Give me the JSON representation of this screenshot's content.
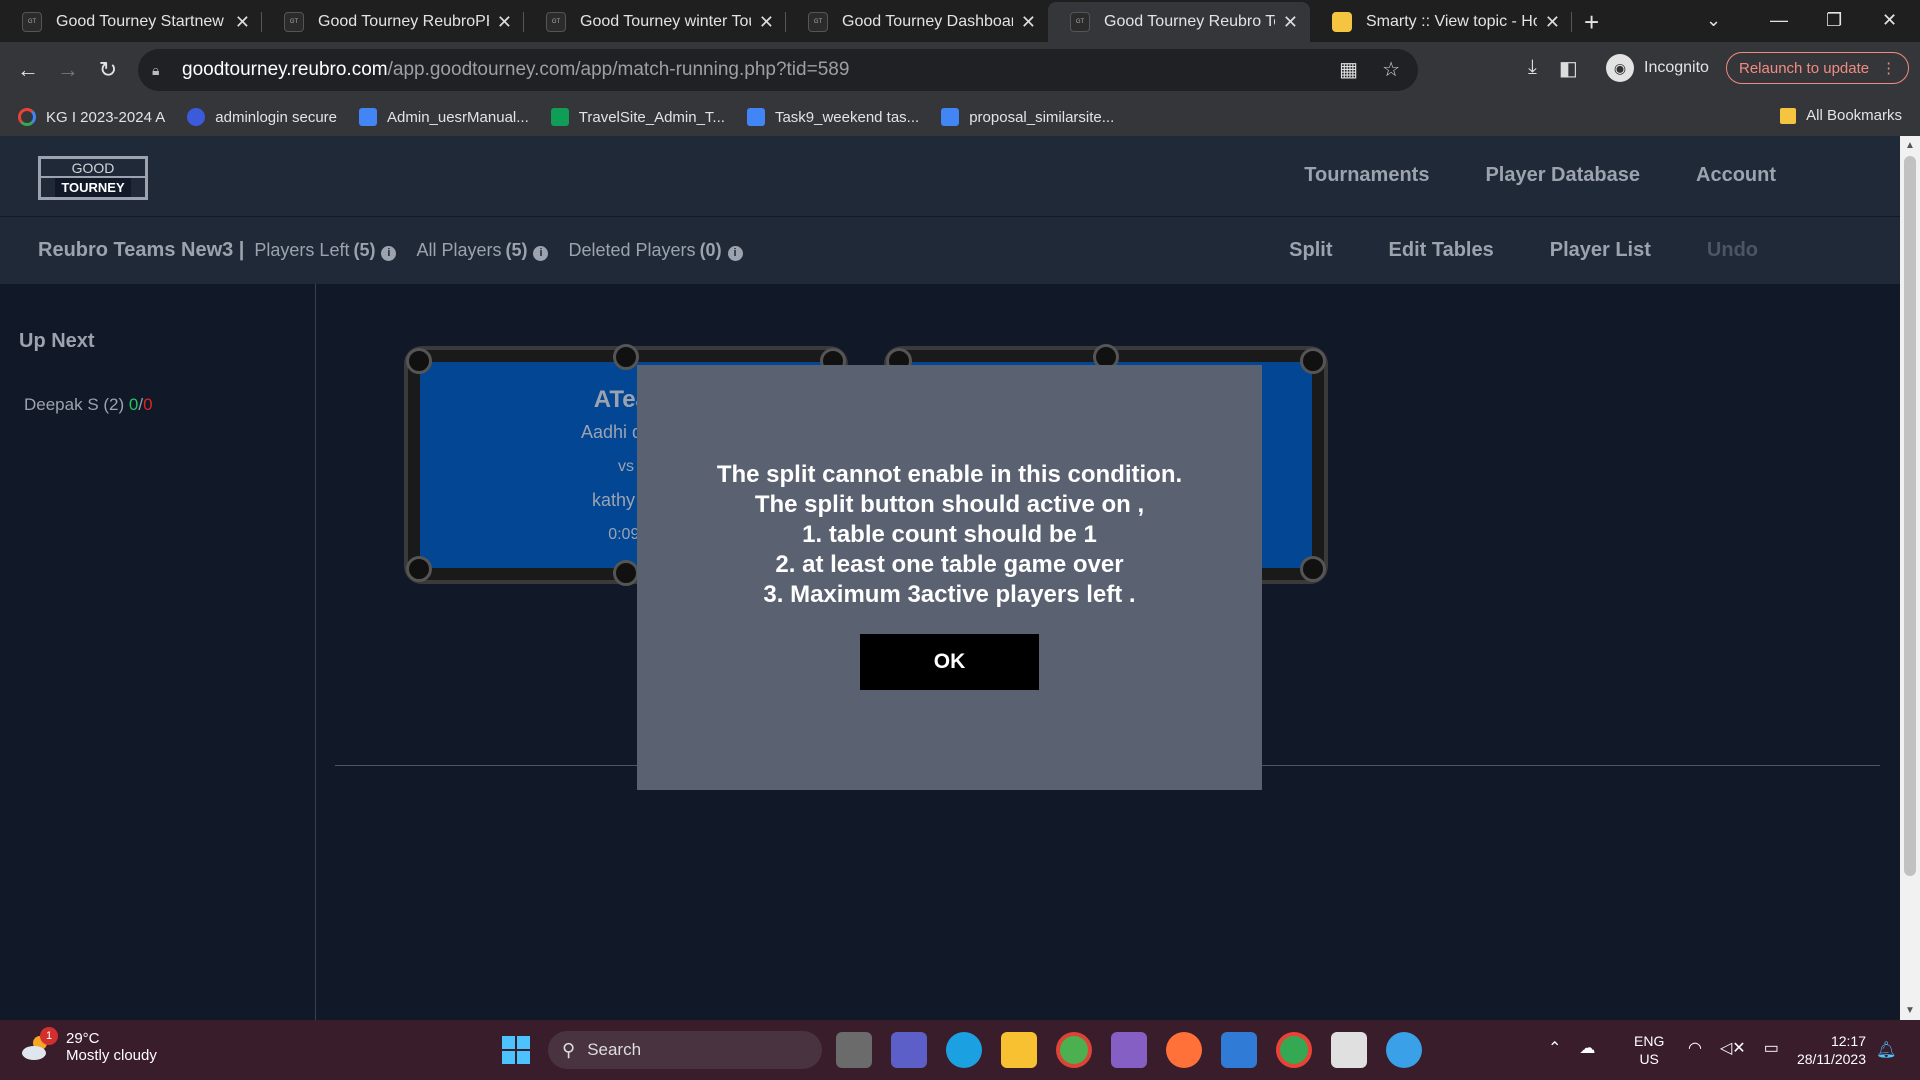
{
  "browser": {
    "tabs": [
      {
        "title": "Good Tourney Startnew To",
        "favicon": "good-tourney-logo",
        "active": false
      },
      {
        "title": "Good Tourney ReubroPHP",
        "favicon": "good-tourney-logo",
        "active": false
      },
      {
        "title": "Good Tourney winter Tourr",
        "favicon": "good-tourney-logo",
        "active": false
      },
      {
        "title": "Good Tourney Dashboard",
        "favicon": "good-tourney-logo",
        "active": false
      },
      {
        "title": "Good Tourney Reubro Tean",
        "favicon": "good-tourney-logo",
        "active": true
      },
      {
        "title": "Smarty :: View topic - How",
        "favicon": "smarty-logo",
        "active": false
      }
    ],
    "url_host": "goodtourney.reubro.com",
    "url_path": "/app.goodtourney.com/app/match-running.php?tid=589",
    "incognito_label": "Incognito",
    "relaunch_label": "Relaunch to update",
    "bookmarks": [
      {
        "label": "KG I 2023-2024 A",
        "icon": "google-icon",
        "color": "#ffffff"
      },
      {
        "label": "adminlogin secure",
        "icon": "code-icon",
        "color": "#3b5bdb"
      },
      {
        "label": "Admin_uesrManual...",
        "icon": "docs-icon",
        "color": "#4285f4"
      },
      {
        "label": "TravelSite_Admin_T...",
        "icon": "sheets-icon",
        "color": "#0f9d58"
      },
      {
        "label": "Task9_weekend tas...",
        "icon": "docs-icon",
        "color": "#4285f4"
      },
      {
        "label": "proposal_similarsite...",
        "icon": "docs-icon",
        "color": "#4285f4"
      }
    ],
    "all_bookmarks_label": "All Bookmarks"
  },
  "app": {
    "logo_top": "GOOD",
    "logo_bottom": "TOURNEY",
    "nav": [
      "Tournaments",
      "Player Database",
      "Account"
    ],
    "tournament_name": "Reubro Teams New3 |",
    "players_left_label": "Players Left",
    "players_left_count": "(5)",
    "all_players_label": "All Players",
    "all_players_count": "(5)",
    "deleted_players_label": "Deleted Players",
    "deleted_players_count": "(0)",
    "actions": {
      "split": "Split",
      "edit_tables": "Edit Tables",
      "player_list": "Player List",
      "undo": "Undo"
    },
    "up_next_title": "Up Next",
    "queue": [
      {
        "name": "Deepak S (2)",
        "wins": "0",
        "slash": "/",
        "losses": "0"
      }
    ],
    "table1": {
      "team": "ATear",
      "player1": "Aadhi deva",
      "vs": "vs",
      "player2": "kathy k (",
      "timer": "0:09:"
    }
  },
  "modal": {
    "message_lines": [
      "The split cannot enable in this condition.",
      "The split button should active on ,",
      "1. table count should be 1",
      "2. at least one table game over",
      "3. Maximum 3active players left ."
    ],
    "ok_label": "OK"
  },
  "taskbar": {
    "weather_badge": "1",
    "temperature": "29°C",
    "weather_desc": "Mostly cloudy",
    "search_placeholder": "Search",
    "lang_line1": "ENG",
    "lang_line2": "US",
    "time": "12:17",
    "date": "28/11/2023"
  }
}
